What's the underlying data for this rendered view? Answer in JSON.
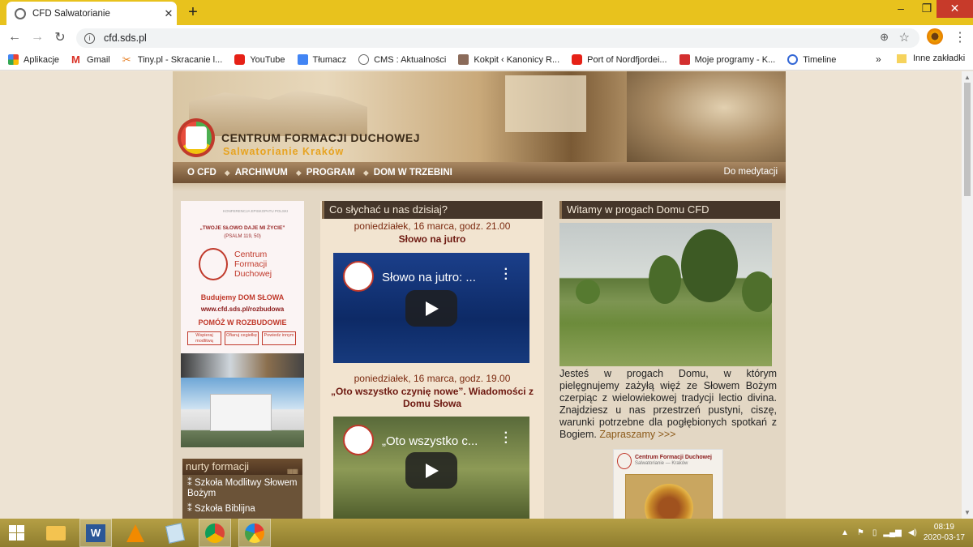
{
  "browser": {
    "tab_title": "CFD Salwatorianie",
    "url": "cfd.sds.pl",
    "bookmarks": [
      "Aplikacje",
      "Gmail",
      "Tiny.pl - Skracanie l...",
      "YouTube",
      "Tłumacz",
      "CMS : Aktualności",
      "Kokpit ‹ Kanonicy R...",
      "Port of Nordfjordei...",
      "Moje programy - K...",
      "Timeline"
    ],
    "bookmarks_more": "»",
    "bookmarks_other": "Inne zakładki"
  },
  "site": {
    "title": "CENTRUM FORMACJI DUCHOWEJ",
    "subtitle": "Salwatorianie Kraków",
    "nav": [
      "O CFD",
      "ARCHIWUM",
      "PROGRAM",
      "DOM W TRZEBINI"
    ],
    "nav_right": "Do medytacji"
  },
  "banner": {
    "konferencja": "KONFERENCJA EPISKOPATU POLSKI",
    "quote": "„TWOJE SŁOWO DAJE MI ŻYCIE”",
    "psalm": "(PSALM 119, 50)",
    "name": "Centrum Formacji Duchowej",
    "budujemy": "Budujemy DOM SŁOWA",
    "url": "www.cfd.sds.pl/rozbudowa",
    "pomoz": "POMÓŻ W ROZBUDOWIE",
    "buttons": [
      "Wspieraj modlitwą",
      "Ofiaruj cegiełkę",
      "Powiedz innym"
    ]
  },
  "nurty": {
    "title": "nurty formacji",
    "items": [
      "Szkoła Modlitwy Słowem Bożym",
      "Szkoła Biblijna"
    ]
  },
  "middle": {
    "title": "Co słychać u nas dzisiaj?",
    "events": [
      {
        "date": "poniedziałek, 16 marca, godz. 21.00",
        "title": "Słowo na jutro",
        "video_title": "Słowo na jutro: ..."
      },
      {
        "date": "poniedziałek, 16 marca, godz. 19.00",
        "title": "„Oto wszystko czynię nowe”. Wiadomości z Domu Słowa",
        "video_title": "„Oto wszystko c..."
      }
    ]
  },
  "right": {
    "title": "Witamy w progach Domu CFD",
    "text": "Jesteś w progach Domu, w którym pielęgnujemy zażyłą więź ze Słowem Bożym czerpiąc z wielowiekowej tradycji lectio divina. Znajdziesz u nas przestrzeń pustyni, ciszę, warunki potrzebne dla pogłębionych spotkań z Bogiem.",
    "link": "Zapraszamy >>>",
    "card_title": "Centrum Formacji Duchowej",
    "card_sub": "Salwatorianie — Kraków"
  },
  "taskbar": {
    "time": "08:19",
    "date": "2020-03-17"
  },
  "colors": {
    "chrome_tab_bar": "#e8c21d",
    "header_nav": "#6f5033",
    "col_head": "#45362a",
    "accent_red": "#c0392b"
  }
}
